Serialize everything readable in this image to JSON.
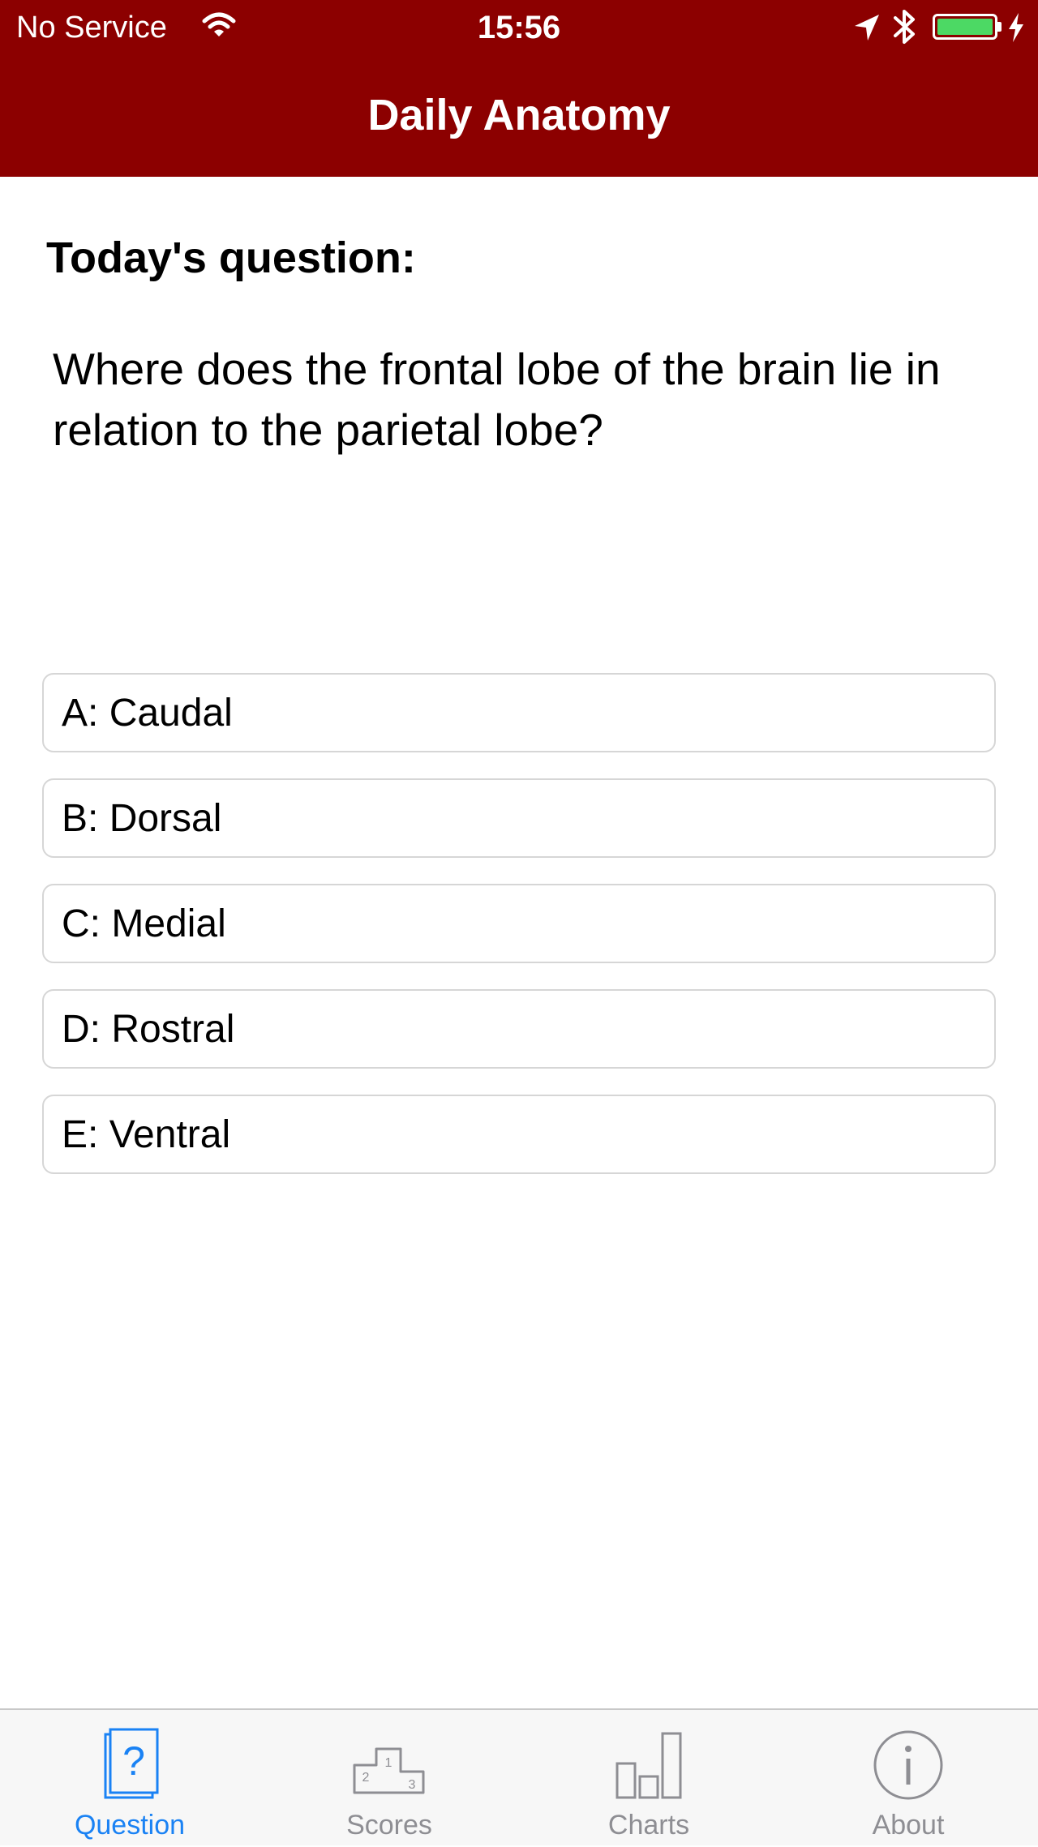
{
  "status_bar": {
    "carrier": "No Service",
    "time": "15:56",
    "icons": [
      "wifi-icon",
      "location-arrow-icon",
      "bluetooth-icon",
      "battery-icon",
      "charging-bolt-icon"
    ],
    "battery_color": "#4cd964"
  },
  "nav": {
    "title": "Daily Anatomy",
    "bar_color": "#8c0000"
  },
  "question": {
    "heading": "Today's question:",
    "text": "Where does the frontal lobe of the brain lie in relation to the parietal lobe?"
  },
  "answers": [
    {
      "label": "A: Caudal"
    },
    {
      "label": "B: Dorsal"
    },
    {
      "label": "C: Medial"
    },
    {
      "label": "D: Rostral"
    },
    {
      "label": "E: Ventral"
    }
  ],
  "tabs": [
    {
      "label": "Question",
      "icon": "question-card-icon",
      "active": true
    },
    {
      "label": "Scores",
      "icon": "podium-icon",
      "active": false
    },
    {
      "label": "Charts",
      "icon": "bar-chart-icon",
      "active": false
    },
    {
      "label": "About",
      "icon": "info-circle-icon",
      "active": false
    }
  ],
  "colors": {
    "active_tab": "#1a82f4",
    "inactive_tab": "#8e8e93"
  }
}
